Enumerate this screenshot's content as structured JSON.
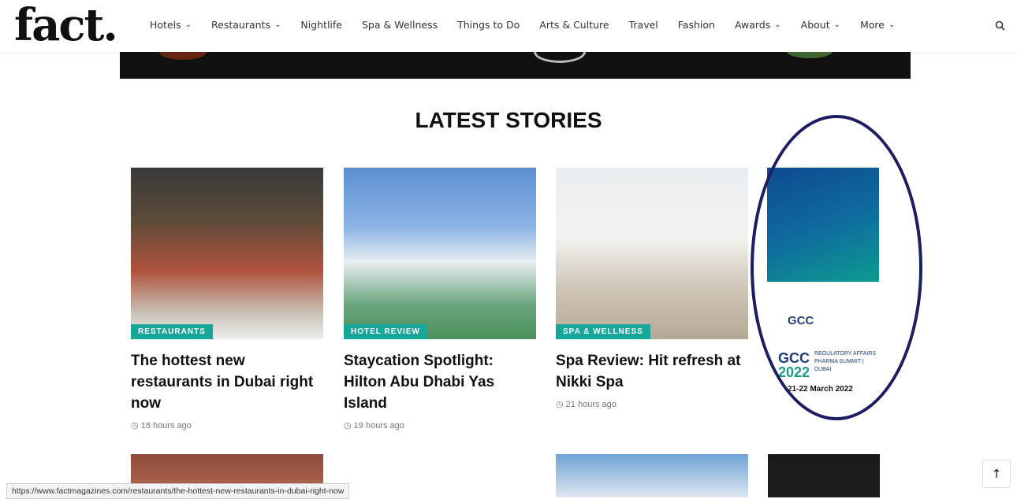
{
  "header": {
    "logo": "fact.",
    "nav": [
      {
        "label": "Hotels",
        "dropdown": true
      },
      {
        "label": "Restaurants",
        "dropdown": true
      },
      {
        "label": "Nightlife",
        "dropdown": false
      },
      {
        "label": "Spa & Wellness",
        "dropdown": false
      },
      {
        "label": "Things to Do",
        "dropdown": false
      },
      {
        "label": "Arts & Culture",
        "dropdown": false
      },
      {
        "label": "Travel",
        "dropdown": false
      },
      {
        "label": "Fashion",
        "dropdown": false
      },
      {
        "label": "Awards",
        "dropdown": true
      },
      {
        "label": "About",
        "dropdown": true
      },
      {
        "label": "More",
        "dropdown": true
      }
    ],
    "search_icon": "search-icon"
  },
  "section": {
    "title": "LATEST STORIES"
  },
  "cards": [
    {
      "tag": "RESTAURANTS",
      "title": "The hottest new restaurants in Dubai right now",
      "time": "18 hours ago"
    },
    {
      "tag": "HOTEL REVIEW",
      "title": "Staycation Spotlight: Hilton Abu Dhabi Yas Island",
      "time": "19 hours ago"
    },
    {
      "tag": "SPA & WELLNESS",
      "title": "Spa Review: Hit refresh at Nikki Spa",
      "time": "21 hours ago"
    }
  ],
  "ad": {
    "brand": "GCC",
    "headline_gcc": "GCC",
    "year": "2022",
    "subtitle": "REGULATORY AFFAIRS PHARMA SUMMIT | DUBAI",
    "dates": "21-22 March 2022"
  },
  "statusbar": {
    "url": "https://www.factmagazines.com/restaurants/the-hottest-new-restaurants-in-dubai-right-now"
  },
  "colors": {
    "tag_bg": "#17a69a",
    "annotation_ellipse": "#1c1e63"
  }
}
